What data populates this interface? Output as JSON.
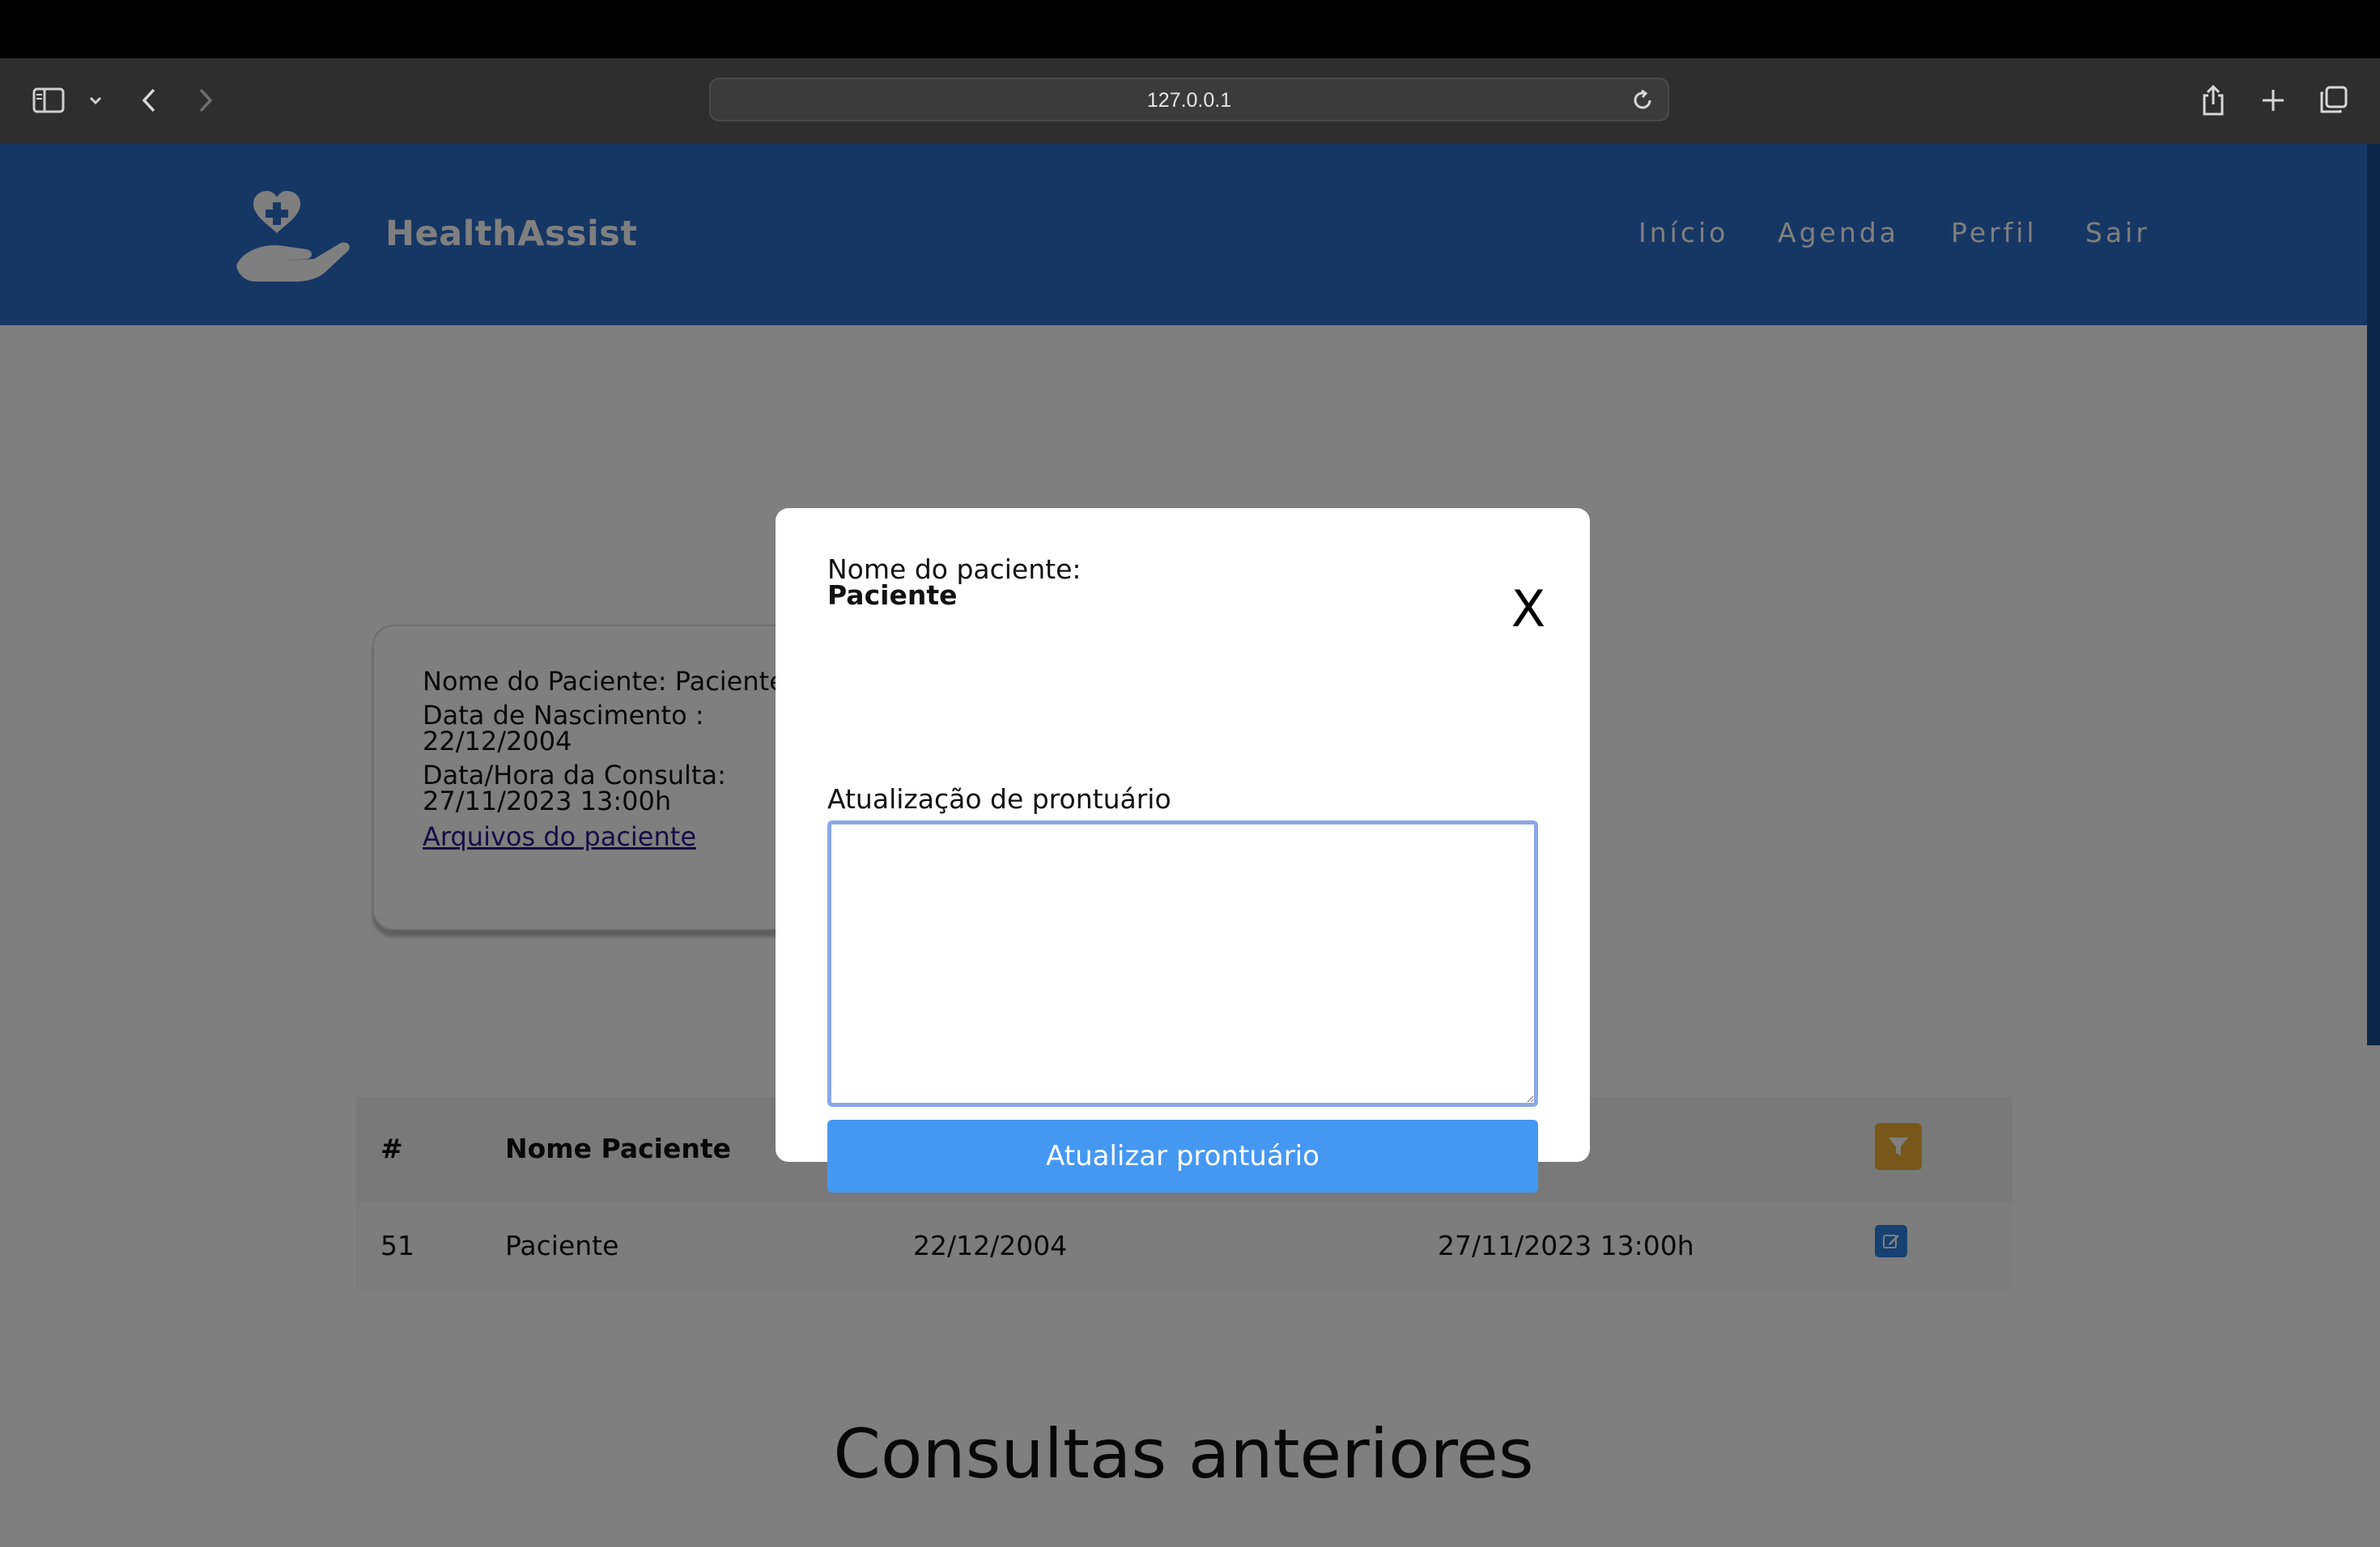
{
  "browser": {
    "url": "127.0.0.1"
  },
  "header": {
    "brand": "HealthAssist",
    "nav": [
      "Início",
      "Agenda",
      "Perfil",
      "Sair"
    ]
  },
  "patient_card": {
    "name_line": "Nome do Paciente: Paciente",
    "birth_label": "Data de Nascimento :",
    "birth_value": "22/12/2004",
    "consult_label": "Data/Hora da Consulta:",
    "consult_value": "27/11/2023 13:00h",
    "files_link": "Arquivos do paciente"
  },
  "table": {
    "headers": [
      "#",
      "Nome Paciente"
    ],
    "rows": [
      {
        "id": "51",
        "name": "Paciente",
        "birth": "22/12/2004",
        "datetime": "27/11/2023 13:00h"
      }
    ]
  },
  "section_title": "Consultas anteriores",
  "modal": {
    "patient_label": "Nome do paciente:",
    "patient_name": "Paciente",
    "close_label": "X",
    "textarea_label": "Atualização de prontuário",
    "textarea_value": "",
    "submit_label": "Atualizar prontuário"
  },
  "colors": {
    "header_bg": "#2d6fc8",
    "submit_bg": "#4598f2",
    "filter_bg": "#f0b035",
    "edit_bg": "#2d83e0"
  }
}
